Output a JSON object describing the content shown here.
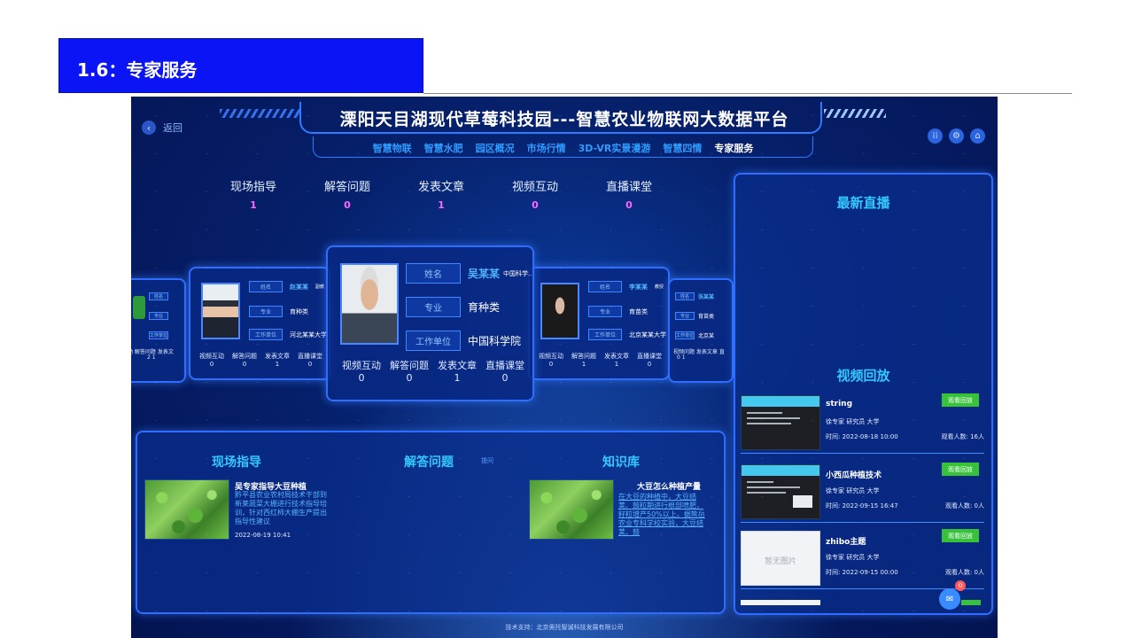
{
  "slide": {
    "title": "1.6：专家服务"
  },
  "header": {
    "back_label": "返回",
    "title": "溧阳天目湖现代草莓科技园---智慧农业物联网大数据平台",
    "nav": [
      "智慧物联",
      "智慧水肥",
      "园区概况",
      "市场行情",
      "3D-VR实景漫游",
      "智慧四情",
      "专家服务"
    ],
    "active_nav": "专家服务",
    "icons": [
      "grid-icon",
      "settings-icon",
      "home-icon"
    ]
  },
  "stats": [
    {
      "label": "现场指导",
      "value": "1"
    },
    {
      "label": "解答问题",
      "value": "0"
    },
    {
      "label": "发表文章",
      "value": "1"
    },
    {
      "label": "视频互动",
      "value": "0"
    },
    {
      "label": "直播课堂",
      "value": "0"
    }
  ],
  "experts": {
    "field_labels": {
      "name": "姓名",
      "major": "专业",
      "unit": "工作单位"
    },
    "foot_labels": [
      "视频互动",
      "解答问题",
      "发表文章",
      "直播课堂"
    ],
    "featured": {
      "name": "吴某某",
      "title": "中国科学...",
      "major": "育种类",
      "unit": "中国科学院",
      "counts": [
        "0",
        "0",
        "1",
        "0"
      ]
    },
    "left": {
      "name": "赵某某",
      "title": "副教",
      "major": "育种类",
      "unit": "河北某某大学",
      "counts": [
        "0",
        "0",
        "1",
        "0"
      ]
    },
    "right": {
      "name": "李某某",
      "title": "教授",
      "major": "育苗类",
      "unit": "北京某某大学",
      "counts": [
        "0",
        "1",
        "1",
        "0"
      ]
    },
    "far_right": {
      "name": "张某某",
      "major": "育苗类",
      "unit": "北京某",
      "foot": "视频问题 发表文章 直",
      "counts": "0 1"
    },
    "far_left": {
      "foot": "动 解答问题 发表文",
      "counts": "2 1"
    }
  },
  "bottom": {
    "field_guide": {
      "title": "现场指导"
    },
    "qa": {
      "title": "解答问题",
      "more": "提问"
    },
    "knowledge": {
      "title": "知识库"
    },
    "article1": {
      "title": "吴专家指导大豆种植",
      "body": "黔平县农业农村局技术干部到新莱蔬菜大棚进行技术指导培训，针对西红柿大棚生产提出指导性建议",
      "date": "2022-08-19 10:41"
    },
    "article2": {
      "title": "大豆怎么种植产量",
      "body": "在大豆的种植中，大豆结荚、鼓粒期进行根部喷肥，籽粒增产50%以上。据熊岳农业专科学校实验，大豆结荚、鼓"
    }
  },
  "right_panel": {
    "live_title": "最新直播",
    "replay_title": "视频回放",
    "button_label": "观看回放",
    "empty_thumb": "暂无图片",
    "videos": [
      {
        "name": "string",
        "meta": "徐专家 研究员 大学",
        "time": "时间: 2022-08-18 10:00",
        "views": "观看人数: 16人"
      },
      {
        "name": "小西瓜种植技术",
        "meta": "徐专家 研究员 大学",
        "time": "时间: 2022-09-15 16:47",
        "views": "观看人数: 0人"
      },
      {
        "name": "zhibo主题",
        "meta": "徐专家 研究员 大学",
        "time": "时间: 2022-09-15 00:00",
        "views": "观看人数: 0人"
      }
    ],
    "fab_badge": "0"
  },
  "footer": {
    "support": "技术支持：北京奥托智诚科技发展有限公司"
  },
  "colors": {
    "slide_banner": "#0b14f5",
    "accent": "#33c8ff",
    "button_green": "#37c23a",
    "stat_value": "#ff66ff"
  }
}
